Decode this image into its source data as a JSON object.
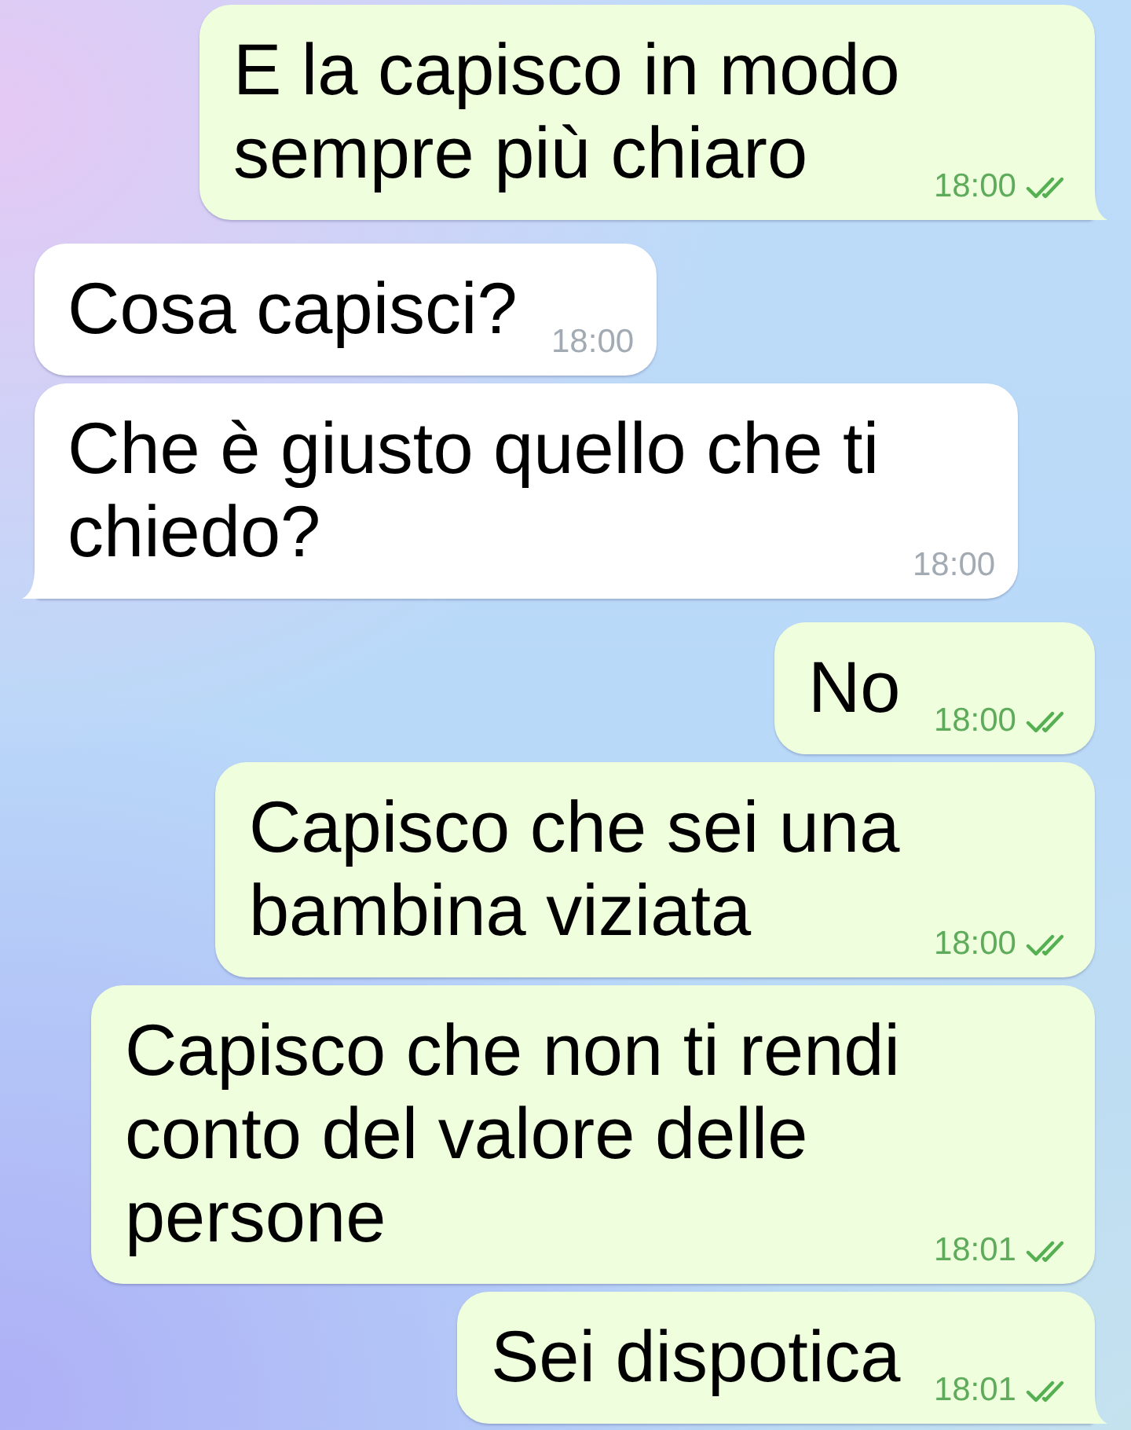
{
  "messages": [
    {
      "kind": "outgoing",
      "text": "E la capisco in modo sempre più chiaro",
      "time": "18:00",
      "read": true
    },
    {
      "kind": "incoming",
      "text": "Cosa capisci?",
      "time": "18:00"
    },
    {
      "kind": "incoming",
      "text": "Che è giusto quello che ti chiedo?",
      "time": "18:00"
    },
    {
      "kind": "outgoing",
      "text": "No",
      "time": "18:00",
      "read": true
    },
    {
      "kind": "outgoing",
      "text": "Capisco che sei una bambina viziata",
      "time": "18:00",
      "read": true
    },
    {
      "kind": "outgoing",
      "text": "Capisco che non ti rendi conto del valore delle persone",
      "time": "18:01",
      "read": true
    },
    {
      "kind": "outgoing",
      "text": "Sei dispotica",
      "time": "18:01",
      "read": true
    }
  ]
}
